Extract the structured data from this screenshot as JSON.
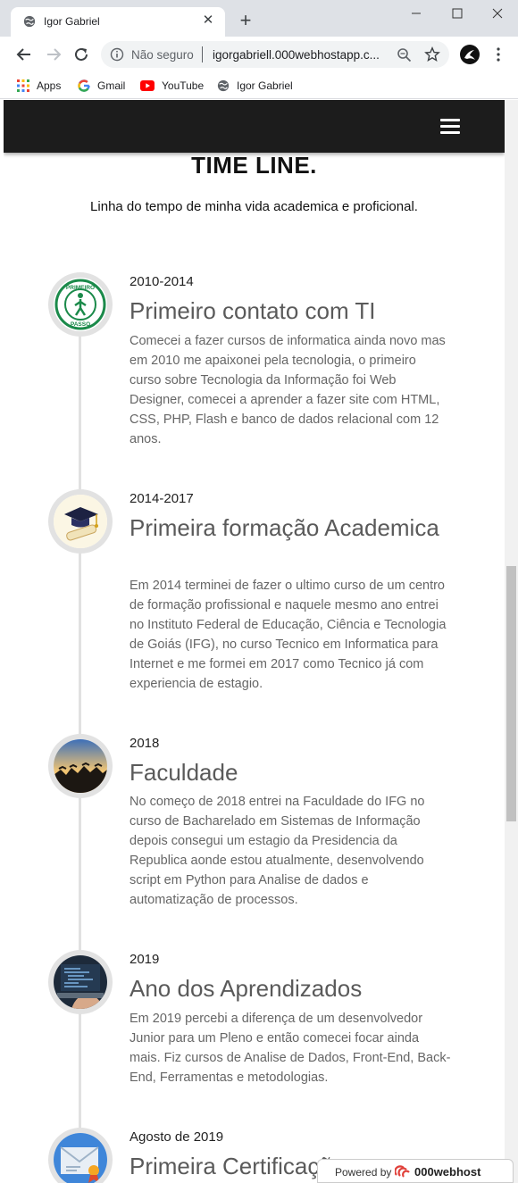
{
  "browser": {
    "tab_title": "Igor Gabriel",
    "security_label": "Não seguro",
    "url": "igorgabriell.000webhostapp.c...",
    "bookmarks": [
      {
        "label": "Apps",
        "icon": "apps-grid-icon"
      },
      {
        "label": "Gmail",
        "icon": "google-icon"
      },
      {
        "label": "YouTube",
        "icon": "youtube-icon"
      },
      {
        "label": "Igor Gabriel",
        "icon": "globe-icon"
      }
    ]
  },
  "page": {
    "title": "TIME LINE.",
    "subtitle": "Linha do tempo de minha vida academica e proficional.",
    "entries": [
      {
        "date": "2010-2014",
        "heading": "Primeiro contato com TI",
        "text": "Comecei a fazer cursos de informatica ainda novo mas em 2010 me apaixonei pela tecnologia, o primeiro curso sobre Tecnologia da Informação foi Web Designer, comecei a aprender a fazer site com HTML, CSS, PHP, Flash e banco de dados relacional com 12 anos.",
        "icon": "primeiro-passo-logo",
        "icon_text_top": "PRIMEIRO",
        "icon_text_bottom": "PASSO"
      },
      {
        "date": "2014-2017",
        "heading": "Primeira formação Academica",
        "text": "Em 2014 terminei de fazer o ultimo curso de um centro de formação profissional e naquele mesmo ano entrei no Instituto Federal de Educação, Ciência e Tecnologia de Goiás (IFG), no curso Tecnico em Informatica para Internet e me formei em 2017 como Tecnico já com experiencia de estagio.",
        "icon": "graduation-cap-diploma-icon"
      },
      {
        "date": "2018",
        "heading": "Faculdade",
        "text": "No começo de 2018 entrei na Faculdade do IFG no curso de Bacharelado em Sistemas de Informação depois consegui um estagio da Presidencia da Republica aonde estou atualmente, desenvolvendo script em Python para Analise de dados e automatização de processos.",
        "icon": "graduates-photo-icon"
      },
      {
        "date": "2019",
        "heading": "Ano dos Aprendizados",
        "text": "Em 2019 percebi a diferença de um desenvolvedor Junior para um Pleno e então comecei focar ainda mais. Fiz cursos de Analise de Dados, Front-End, Back-End, Ferramentas e metodologias.",
        "icon": "coding-laptop-photo-icon"
      },
      {
        "date": "Agosto de 2019",
        "heading": "Primeira Certificação",
        "text": "",
        "icon": "certificate-envelope-icon"
      }
    ]
  },
  "badge": {
    "powered_by": "Powered by",
    "brand": "000webhost"
  }
}
